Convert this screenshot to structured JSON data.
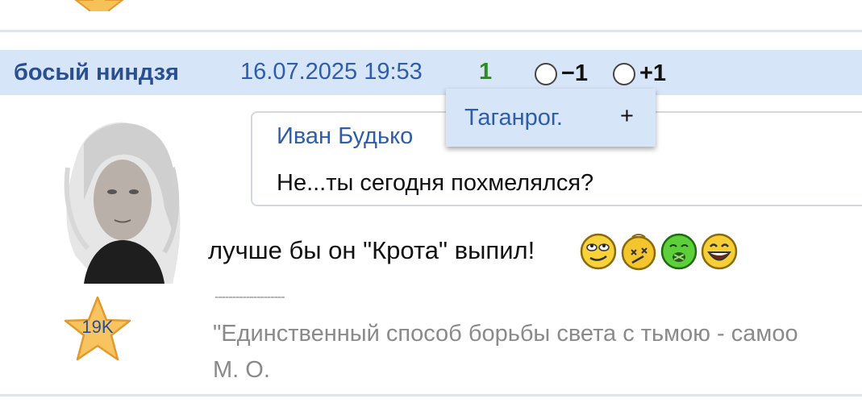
{
  "post": {
    "author": "босый ниндзя",
    "date": "16.07.2025 19:53",
    "score": "1",
    "vote_minus_label": "−1",
    "vote_plus_label": "+1",
    "rating_badge": "19K",
    "quote": {
      "author": "Иван Будько",
      "text": "Не...ты сегодня похмелялся?"
    },
    "message": "лучше бы он \"Крота\" выпил!",
    "smileys": [
      "rolleyes-smiley-icon",
      "dizzy-smiley-icon",
      "sick-smiley-icon",
      "laughing-smiley-icon"
    ],
    "signature_separator": "--------------------",
    "signature_line1": "\"Единственный способ борьбы света с тьмою - самоо",
    "signature_line2": "М. О."
  },
  "popup": {
    "city": "Таганрог.",
    "add": "+"
  },
  "colors": {
    "header_bg": "#d7e5f8",
    "author": "#2a4f8f",
    "link": "#2f5ea8",
    "score_positive": "#2f8a22",
    "signature": "#8a8a8a"
  }
}
